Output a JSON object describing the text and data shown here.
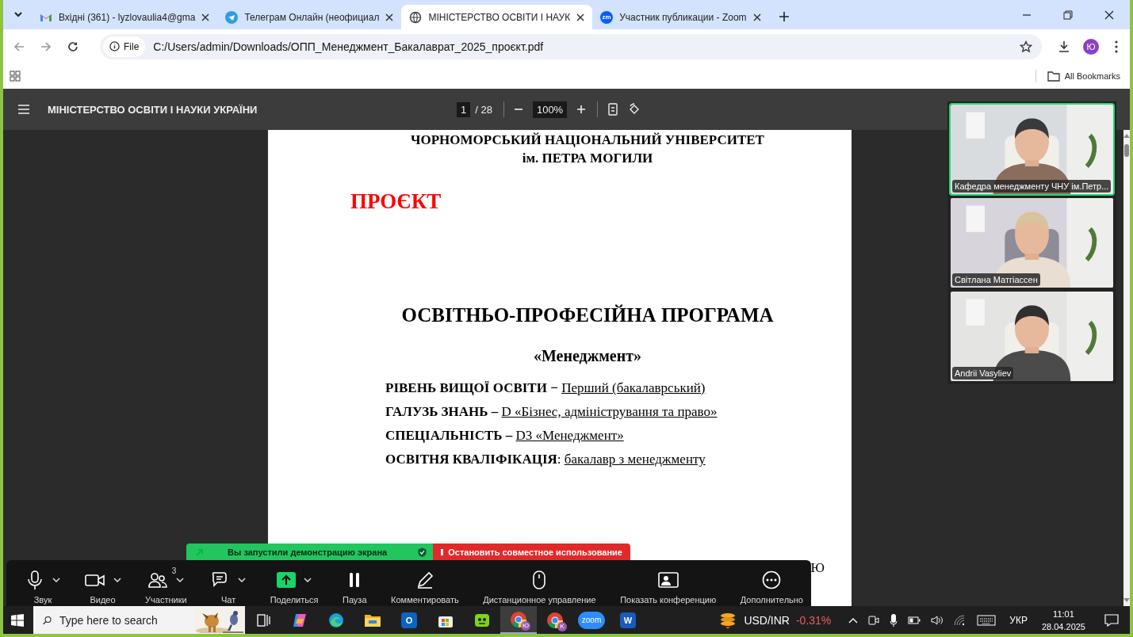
{
  "browser": {
    "tabs": [
      {
        "kind": "gmail",
        "title": "Вхідні (361) - lyzlovaulia4@gma",
        "selected": false
      },
      {
        "kind": "telegram",
        "title": "Телеграм Онлайн (неофициал",
        "selected": false
      },
      {
        "kind": "globe",
        "title": "МІНІСТЕРСТВО ОСВІТИ І НАУК",
        "selected": true
      },
      {
        "kind": "zoom",
        "icon_text": "zm",
        "title": "Участник публикации - Zoom",
        "selected": false
      }
    ],
    "address": {
      "scheme": "File",
      "url": "C:/Users/admin/Downloads/ОПП_Менеджмент_Бакалаврат_2025_проєкт.pdf"
    },
    "profile": "Ю",
    "bookmarks": {
      "all": "All Bookmarks"
    }
  },
  "pdf": {
    "title": "МІНІСТЕРСТВО ОСВІТИ І НАУКИ УКРАЇНИ",
    "page": "1",
    "pages": "/ 28",
    "zoom": "100%",
    "document": {
      "header": [
        "ЧОРНОМОРСЬКИЙ НАЦІОНАЛЬНИЙ УНІВЕРСИТЕТ",
        "ім. ПЕТРА МОГИЛИ"
      ],
      "stamp": "ПРОЄКТ",
      "title": "ОСВІТНЬО-ПРОФЕСІЙНА ПРОГРАМА",
      "subtitle": "«Менеджмент»",
      "details": [
        {
          "label": "РІВЕНЬ ВИЩОЇ ОСВІТИ −",
          "value": " Перший (бакалаврський)"
        },
        {
          "label": "ГАЛУЗЬ ЗНАНЬ –",
          "value": "D «Бізнес, адміністрування та право»"
        },
        {
          "label": "СПЕЦІАЛЬНІСТЬ  –",
          "value": "D3 «Менеджмент»"
        },
        {
          "label": "ОСВІТНЯ КВАЛІФІКАЦІЯ",
          "separator": ":",
          "value": "бакалавр з менеджменту"
        }
      ],
      "fragment": "Ю"
    }
  },
  "zoom": {
    "participants": [
      {
        "name": "Кафедра менеджменту ЧНУ ім.Петр...",
        "speaking": true
      },
      {
        "name": "Світлана Матгіассен",
        "speaking": false
      },
      {
        "name": "Andrii Vasyliev",
        "speaking": false
      }
    ],
    "share_banner": {
      "status": "Вы запустили демонстрацию экрана",
      "stop": "Остановить совместное использование"
    },
    "toolbar": [
      {
        "kind": "mic",
        "label": "Звук",
        "caret": true
      },
      {
        "kind": "video",
        "label": "Видео",
        "caret": true
      },
      {
        "kind": "participants",
        "label": "Участники",
        "badge": "3",
        "caret": true
      },
      {
        "kind": "chat",
        "label": "Чат",
        "caret": true
      },
      {
        "kind": "share",
        "label": "Поделиться",
        "caret": true
      },
      {
        "kind": "pause",
        "label": "Пауза",
        "caret": false
      },
      {
        "kind": "annotate",
        "label": "Комментировать",
        "caret": false
      },
      {
        "kind": "remote",
        "label": "Дистанционное управление",
        "caret": false
      },
      {
        "kind": "view",
        "label": "Показать конференцию",
        "caret": false
      },
      {
        "kind": "more",
        "label": "Дополнительно",
        "caret": false
      }
    ]
  },
  "taskbar": {
    "search_placeholder": "Type here to search",
    "apps": [
      {
        "kind": "taskview",
        "selected": false
      },
      {
        "kind": "copilot",
        "selected": false
      },
      {
        "kind": "edge",
        "selected": false
      },
      {
        "kind": "explorer",
        "selected": false
      },
      {
        "kind": "outlook",
        "text": "O",
        "selected": false
      },
      {
        "kind": "store",
        "selected": false
      },
      {
        "kind": "greenapp",
        "selected": false
      },
      {
        "kind": "chrome",
        "badge": "Ю",
        "selected": true
      },
      {
        "kind": "chrome",
        "badge": "K",
        "selected": false
      },
      {
        "kind": "zoom",
        "text": "zoom",
        "selected": false
      },
      {
        "kind": "word",
        "text": "W",
        "selected": false
      }
    ],
    "ticker": {
      "pair": "USD/INR",
      "change": "-0.31%"
    },
    "language": "УКР",
    "time": "11:01",
    "date": "28.04.2025"
  }
}
